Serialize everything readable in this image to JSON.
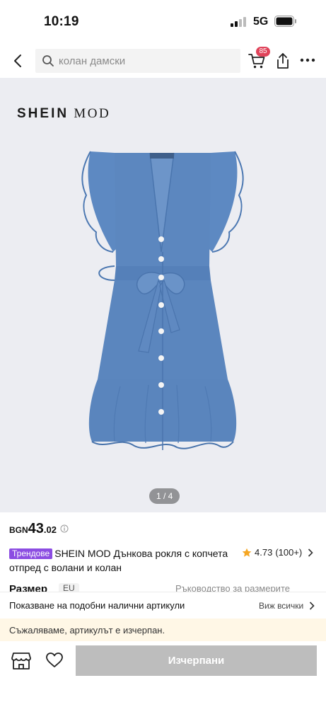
{
  "status_bar": {
    "time": "10:19",
    "network": "5G"
  },
  "header": {
    "search_placeholder": "колан дамски",
    "cart_count": "85"
  },
  "brand": {
    "logo_part1": "SHEIN",
    "logo_part2": "MOD"
  },
  "gallery": {
    "counter": "1 / 4"
  },
  "product": {
    "currency": "BGN",
    "price_main": "43",
    "price_decimals": ".02",
    "badge": "Трендове",
    "title": "SHEIN MOD Дънкова рокля с копчета отпред с волани и колан",
    "rating": "4.73",
    "reviews": "(100+)"
  },
  "size": {
    "label": "Размер",
    "selected": "EU",
    "guide": "Ръководство за размерите"
  },
  "similar": {
    "text": "Показване на подобни налични артикули",
    "view_all": "Виж всички"
  },
  "notice": {
    "out_of_stock": "Съжаляваме, артикулът е изчерпан."
  },
  "actions": {
    "sold_out_label": "Изчерпани"
  },
  "colors": {
    "badge_purple": "#8c4de2",
    "cart_badge": "#e0435a",
    "star": "#f5a623",
    "denim": "#5a86bf",
    "disabled_button": "#bdbdbd"
  },
  "icons": [
    "signal-icon",
    "battery-icon",
    "back-icon",
    "search-icon",
    "cart-icon",
    "share-icon",
    "more-icon",
    "info-icon",
    "star-icon",
    "chevron-right-icon",
    "store-icon",
    "heart-icon"
  ]
}
